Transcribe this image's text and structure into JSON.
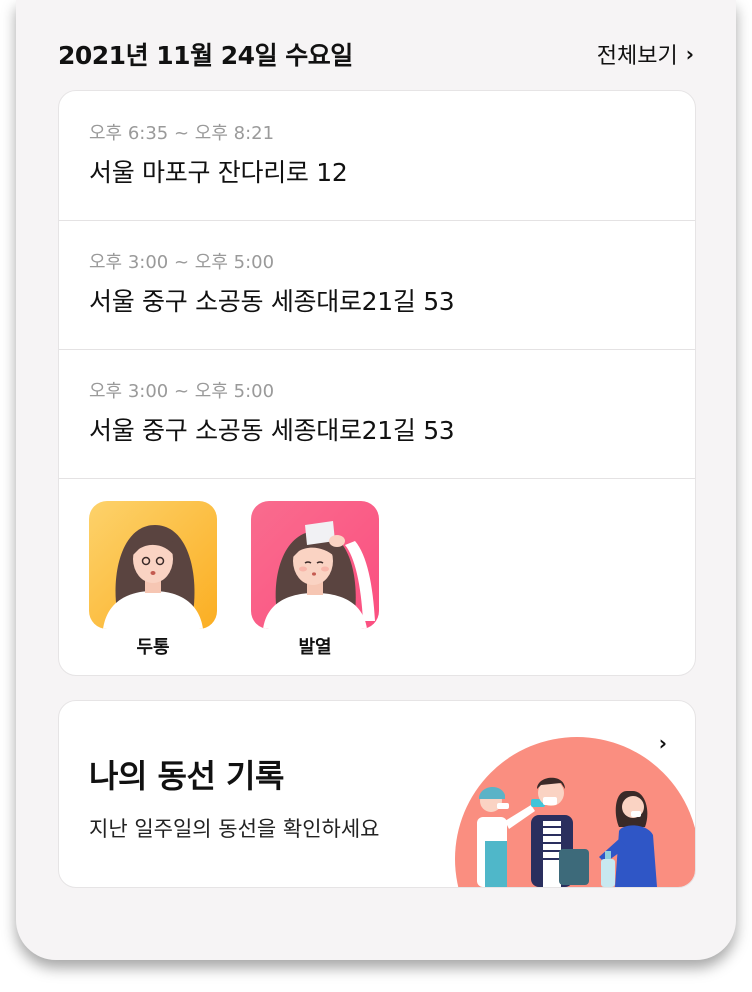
{
  "header": {
    "date": "2021년 11월 24일 수요일",
    "view_all": "전체보기",
    "view_all_icon": "chevron-right-icon"
  },
  "visits": [
    {
      "time": "오후 6:35 ~ 오후 8:21",
      "address": "서울 마포구 잔다리로 12"
    },
    {
      "time": "오후 3:00 ~ 오후 5:00",
      "address": "서울 중구 소공동 세종대로21길 53"
    },
    {
      "time": "오후 3:00 ~ 오후 5:00",
      "address": "서울 중구 소공동 세종대로21길 53"
    }
  ],
  "symptoms": [
    {
      "label": "두통",
      "color": "#fbb62c"
    },
    {
      "label": "발열",
      "color": "#fb5a86"
    }
  ],
  "record": {
    "title": "나의 동선 기록",
    "subtitle": "지난 일주일의 동선을 확인하세요",
    "chevron": "chevron-right-icon",
    "accent": "#fa8e80"
  }
}
